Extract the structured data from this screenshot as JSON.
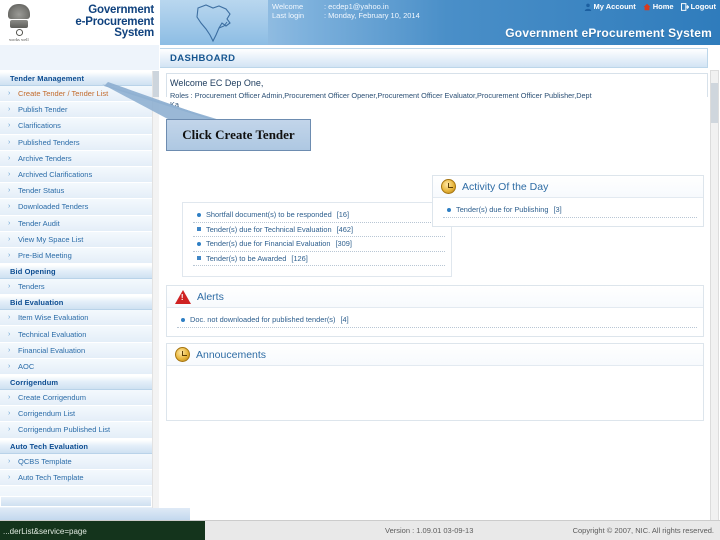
{
  "header": {
    "org_title_line1": "Government",
    "org_title_line2": "e-Procurement",
    "org_title_line3": "System",
    "emblem_motto": "works well",
    "welcome_label": "Welcome",
    "welcome_value": ": ecdep1@yahoo.in",
    "lastlogin_label": "Last login",
    "lastlogin_value": ": Monday, February 10, 2014",
    "band_title": "Government eProcurement System",
    "nav": [
      {
        "label": "My Account",
        "icon": "user-icon"
      },
      {
        "label": "Home",
        "icon": "home-icon"
      },
      {
        "label": "Logout",
        "icon": "logout-icon"
      }
    ],
    "map_icon": "india-map-icon"
  },
  "sidebar": {
    "groups": [
      {
        "title": "Tender Management",
        "items": [
          {
            "label": "Create Tender / Tender List",
            "highlight": true
          },
          {
            "label": "Publish Tender",
            "highlight": false
          },
          {
            "label": "Clarifications",
            "highlight": false
          },
          {
            "label": "Published Tenders",
            "highlight": false
          },
          {
            "label": "Archive Tenders",
            "highlight": false
          },
          {
            "label": "Archived Clarifications",
            "highlight": false
          },
          {
            "label": "Tender Status",
            "highlight": false
          },
          {
            "label": "Downloaded Tenders",
            "highlight": false
          },
          {
            "label": "Tender Audit",
            "highlight": false
          },
          {
            "label": "View My Space List",
            "highlight": false
          },
          {
            "label": "Pre-Bid Meeting",
            "highlight": false
          }
        ]
      },
      {
        "title": "Bid Opening",
        "items": [
          {
            "label": "Tenders",
            "highlight": false
          }
        ]
      },
      {
        "title": "Bid Evaluation",
        "items": [
          {
            "label": "Item Wise Evaluation",
            "highlight": false
          },
          {
            "label": "Technical Evaluation",
            "highlight": false
          },
          {
            "label": "Financial Evaluation",
            "highlight": false
          },
          {
            "label": "AOC",
            "highlight": false
          }
        ]
      },
      {
        "title": "Corrigendum",
        "items": [
          {
            "label": "Create Corrigendum",
            "highlight": false
          },
          {
            "label": "Corrigendum List",
            "highlight": false
          },
          {
            "label": "Corrigendum Published List",
            "highlight": false
          }
        ]
      },
      {
        "title": "Auto Tech Evaluation",
        "items": [
          {
            "label": "QCBS Template",
            "highlight": false
          },
          {
            "label": "Auto Tech Template",
            "highlight": false
          }
        ]
      }
    ]
  },
  "main": {
    "page_title": "DASHBOARD",
    "welcome_user": "Welcome EC Dep One,",
    "roles_line": "Roles : Procurement Officer Admin,Procurement Officer Opener,Procurement Officer Evaluator,Procurement Officer Publisher,Dept",
    "roles_line2": "Ka",
    "pending_items": [
      {
        "label": "Shortfall document(s) to be responded",
        "count": "[16]"
      },
      {
        "label": "Tender(s) due for Technical Evaluation",
        "count": "[462]"
      },
      {
        "label": "Tender(s) due for Financial Evaluation",
        "count": "[309]"
      },
      {
        "label": "Tender(s) to be Awarded",
        "count": "[126]"
      }
    ],
    "activity": {
      "title": "Activity Of the Day",
      "icon": "clock-icon",
      "items": [
        {
          "label": "Tender(s) due for Publishing",
          "count": "[3]"
        }
      ]
    },
    "alerts": {
      "title": "Alerts",
      "icon": "warning-icon",
      "items": [
        {
          "label": "Doc. not downloaded for published tender(s)",
          "count": "[4]"
        }
      ]
    },
    "announcements": {
      "title": "Annoucements",
      "icon": "clock-icon",
      "items": []
    },
    "callout": {
      "text": "Click Create Tender",
      "arrow_icon": "arrow-pointer-icon"
    }
  },
  "footer": {
    "status_text": "...derList&service=page",
    "version": "Version : 1.09.01 03-09-13",
    "copyright": "Copyright © 2007, NIC. All rights reserved."
  },
  "colors": {
    "brand_blue": "#10427e",
    "accent_blue": "#2f7cbc",
    "highlight_orange": "#c26a2b",
    "alert_red": "#cf2222"
  }
}
